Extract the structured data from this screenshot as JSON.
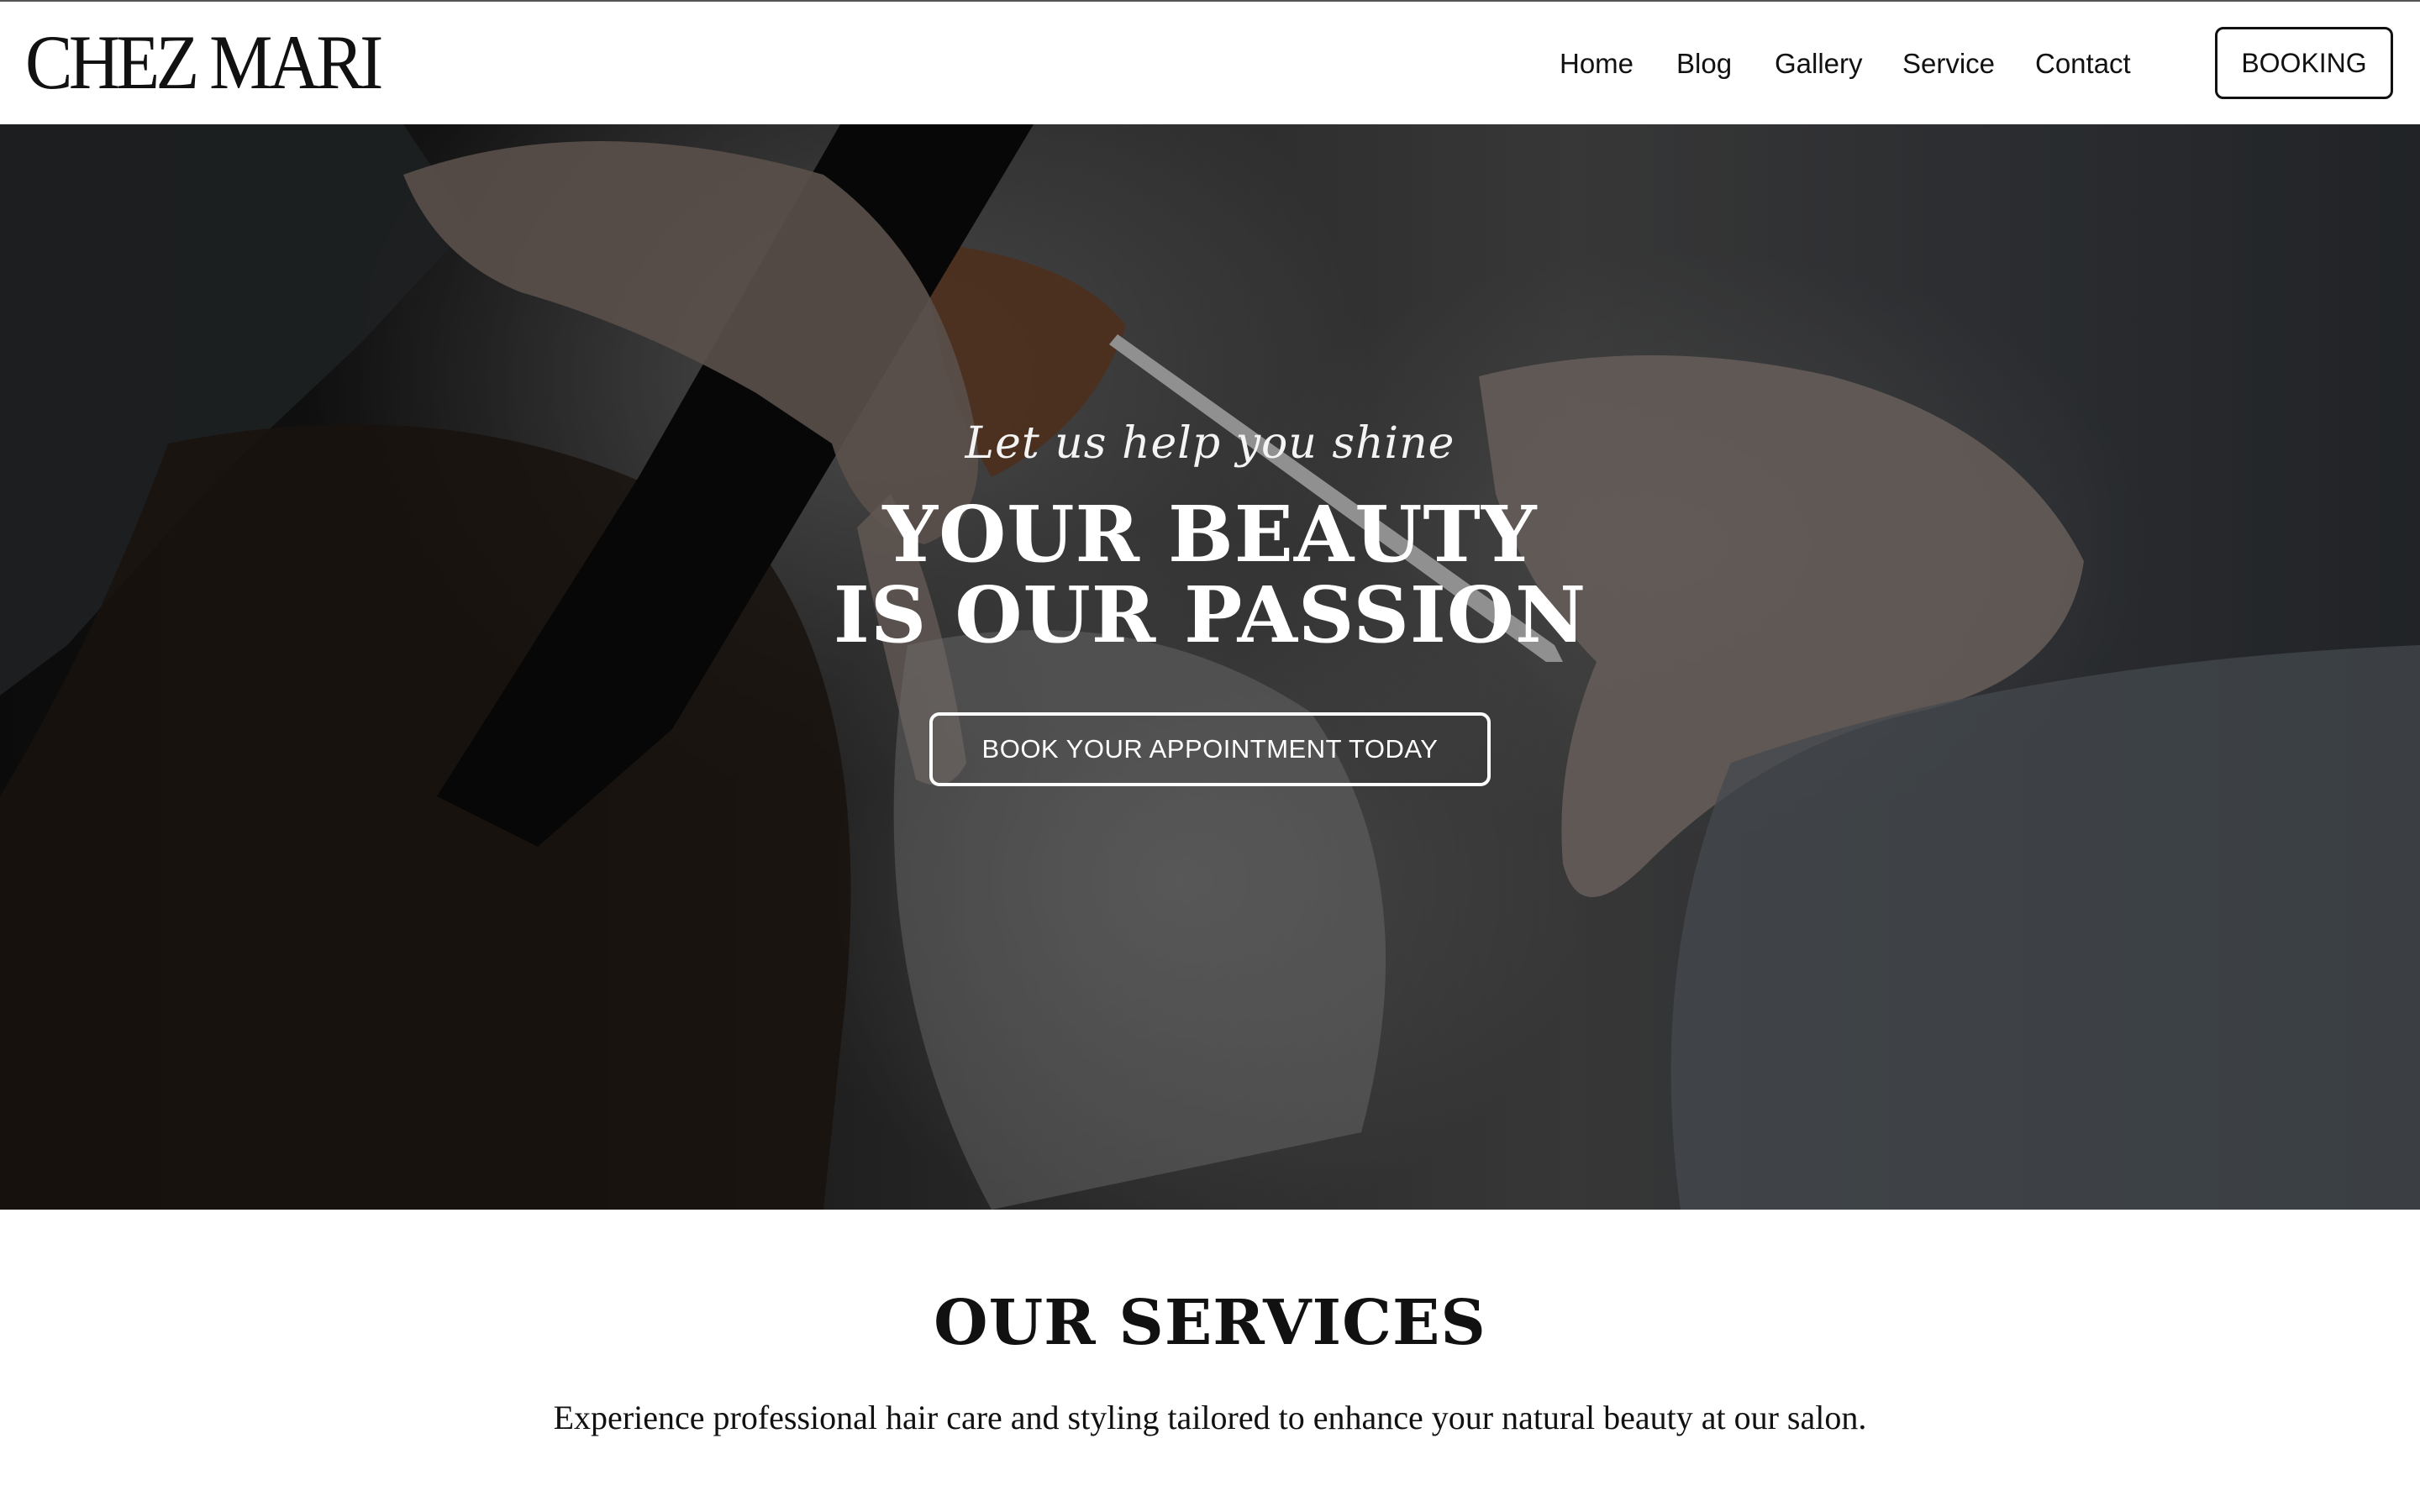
{
  "header": {
    "logo": "CHEZ MARI",
    "nav": [
      {
        "label": "Home"
      },
      {
        "label": "Blog"
      },
      {
        "label": "Gallery"
      },
      {
        "label": "Service"
      },
      {
        "label": "Contact"
      }
    ],
    "booking_label": "BOOKING"
  },
  "hero": {
    "tagline": "Let us help you shine",
    "headline_line1": "YOUR BEAUTY",
    "headline_line2": "IS OUR PASSION",
    "cta_label": "BOOK YOUR APPOINTMENT TODAY",
    "image": "hair-cutting-photo"
  },
  "services": {
    "title": "OUR SERVICES",
    "description": "Experience professional hair care and styling tailored to enhance your natural beauty at our salon."
  },
  "colors": {
    "text": "#111111",
    "background": "#ffffff",
    "hero_text": "#ffffff"
  }
}
